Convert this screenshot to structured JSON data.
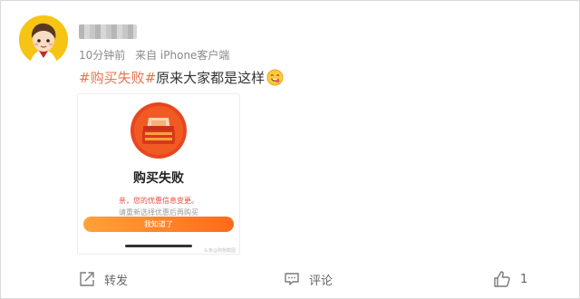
{
  "post": {
    "time": "10分钟前",
    "source": "来自 iPhone客户端",
    "hashtag": "#购买失败#",
    "text": "原来大家都是这样"
  },
  "embed": {
    "title": "购买失败",
    "notice": "亲，您的优惠信息变更。",
    "hint": "请重新选择优惠后再购买",
    "button": "我知道了",
    "watermark": "头条@购物截图"
  },
  "actions": {
    "repost": "转发",
    "comment": "评论",
    "like_count": "1"
  },
  "colors": {
    "hashtag": "#eb7350",
    "embed_button": "#ff7a22",
    "avatar_bg": "#f6c415"
  },
  "icons": {
    "repost": "share-out-icon",
    "comment": "comment-bubble-icon",
    "like": "thumbs-up-icon",
    "emoji": "yummy-face-emoji"
  }
}
